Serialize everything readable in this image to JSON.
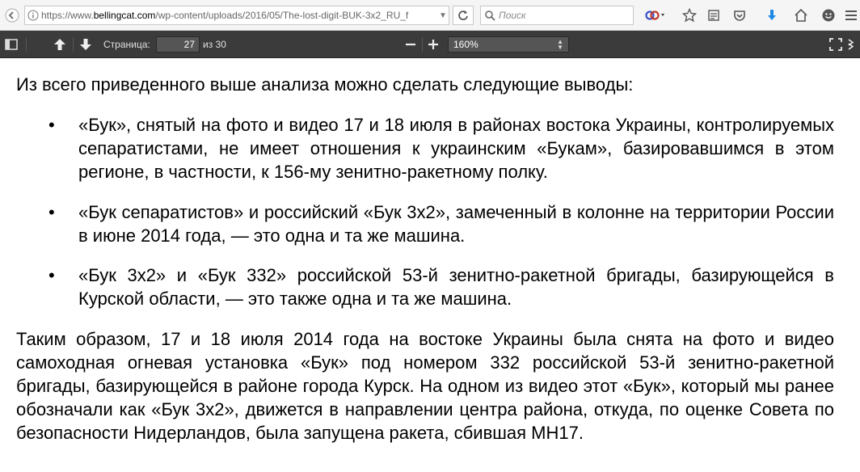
{
  "browser": {
    "url_prefix": "https://www.",
    "url_host": "bellingcat.com",
    "url_path": "/wp-content/uploads/2016/05/The-lost-digit-BUK-3x2_RU_f",
    "search_placeholder": "Поиск"
  },
  "pdf_toolbar": {
    "page_label": "Страница:",
    "page_number": "27",
    "page_of": "из 30",
    "zoom_value": "160%"
  },
  "document": {
    "intro": "Из всего приведенного выше анализа можно сделать следующие выводы:",
    "bullets": [
      {
        "symbol": "•",
        "text": "«Бук», снятый на фото и видео 17 и 18 июля в районах востока Украины, контролируемых сепаратистами, не имеет отношения к украинским «Букам», базировавшимся в этом регионе, в частности, к 156-му зенитно-ракетному полку."
      },
      {
        "symbol": "•",
        "text": "«Бук сепаратистов» и российский «Бук 3х2», замеченный в колонне на территории России в июне 2014 года, — это одна и та же машина."
      },
      {
        "symbol": "•",
        "text": "«Бук 3х2» и «Бук 332» российской 53-й зенитно-ракетной бригады, базирующейся в Курской области, — это также одна и та же машина."
      }
    ],
    "conclusion": "Таким образом, 17 и 18 июля 2014 года на востоке Украины была снята на фото и видео самоходная огневая установка «Бук» под номером 332 российской 53-й зенитно-ракетной бригады, базирующейся в районе города Курск. На одном из видео этот «Бук», который мы ранее обозначали как «Бук 3х2», движется в направлении центра района, откуда, по оценке Совета по безопасности Нидерландов, была запущена ракета, сбившая МН17."
  }
}
